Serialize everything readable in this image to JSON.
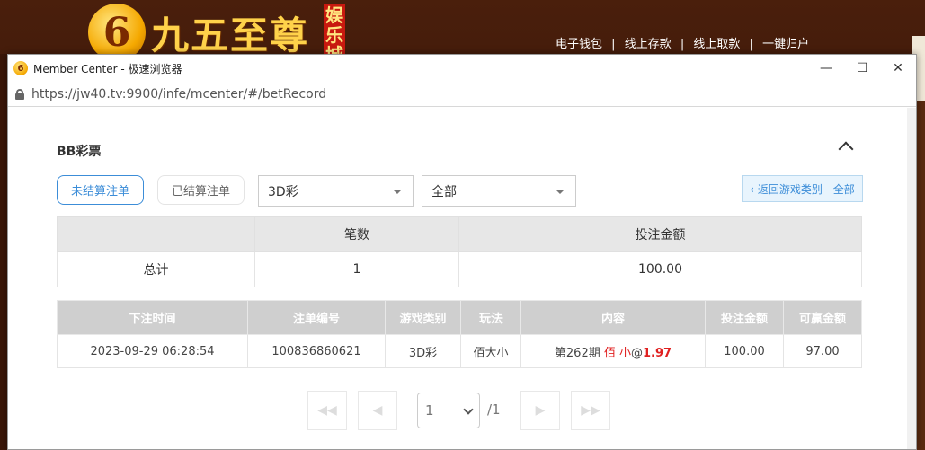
{
  "background_site": {
    "logo_char": "6",
    "logo_text": "九五至尊",
    "logo_sub": [
      "娱",
      "乐",
      "城"
    ],
    "nav": [
      "电子钱包",
      "线上存款",
      "线上取款",
      "一键归户"
    ],
    "nav_sep": "|"
  },
  "window": {
    "title": "Member Center - 极速浏览器",
    "minimize": "—",
    "maximize": "☐",
    "close": "✕",
    "url": "https://jw40.tv:9900/infe/mcenter/#/betRecord"
  },
  "section": {
    "title": "BB彩票"
  },
  "filters": {
    "tab_unsettled": "未结算注单",
    "tab_settled": "已结算注单",
    "game_select": "3D彩",
    "range_select": "全部",
    "back_button": "‹ 返回游戏类别 - 全部"
  },
  "summary": {
    "headers": [
      "",
      "笔数",
      "投注金额"
    ],
    "row": {
      "label": "总计",
      "count": "1",
      "amount": "100.00"
    }
  },
  "bets": {
    "headers": [
      "下注时间",
      "注单编号",
      "游戏类别",
      "玩法",
      "内容",
      "投注金额",
      "可赢金额"
    ],
    "rows": [
      {
        "time": "2023-09-29 06:28:54",
        "id": "100836860621",
        "category": "3D彩",
        "play": "佰大小",
        "content_period": "第262期",
        "content_pick": "佰 小",
        "content_at": "@",
        "content_odds": "1.97",
        "bet_amount": "100.00",
        "win_amount": "97.00"
      }
    ]
  },
  "pager": {
    "first": "◀◀",
    "prev": "◀",
    "page": "1",
    "total": "/1",
    "next": "▶",
    "last": "▶▶"
  }
}
